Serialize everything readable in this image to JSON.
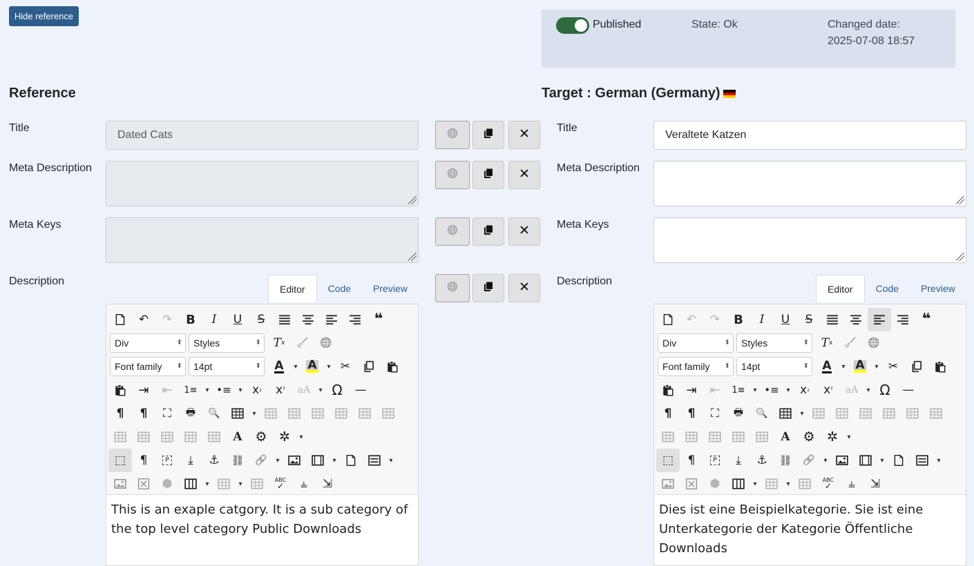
{
  "hide_reference_label": "Hide reference",
  "status": {
    "published_label": "Published",
    "state_text": "State: Ok",
    "changed_label": "Changed date:",
    "changed_value": "2025-07-08 18:57",
    "toggle_color": "#2f6a3c"
  },
  "reference": {
    "heading": "Reference",
    "title_label": "Title",
    "title_value": "Dated Cats",
    "meta_desc_label": "Meta Description",
    "meta_desc_value": "",
    "meta_keys_label": "Meta Keys",
    "meta_keys_value": "",
    "description_label": "Description",
    "tabs": [
      "Editor",
      "Code",
      "Preview"
    ],
    "content": "This is an exaple catgory. It is a sub category of the top level category Public Downloads"
  },
  "target": {
    "heading": "Target : German (Germany)",
    "title_label": "Title",
    "title_value": "Veraltete Katzen",
    "meta_desc_label": "Meta Description",
    "meta_desc_value": "",
    "meta_keys_label": "Meta Keys",
    "meta_keys_value": "",
    "description_label": "Description",
    "tabs": [
      "Editor",
      "Code",
      "Preview"
    ],
    "content": "Dies ist eine Beispielkategorie. Sie ist eine Unterkategorie der Kategorie Öffentliche Downloads"
  },
  "editor_toolbar": {
    "block_select": "Div",
    "styles_select": "Styles",
    "font_family_select": "Font family",
    "font_size_select": "14pt"
  },
  "action_icons": [
    "translate-icon",
    "copy-icon",
    "clear-icon"
  ]
}
